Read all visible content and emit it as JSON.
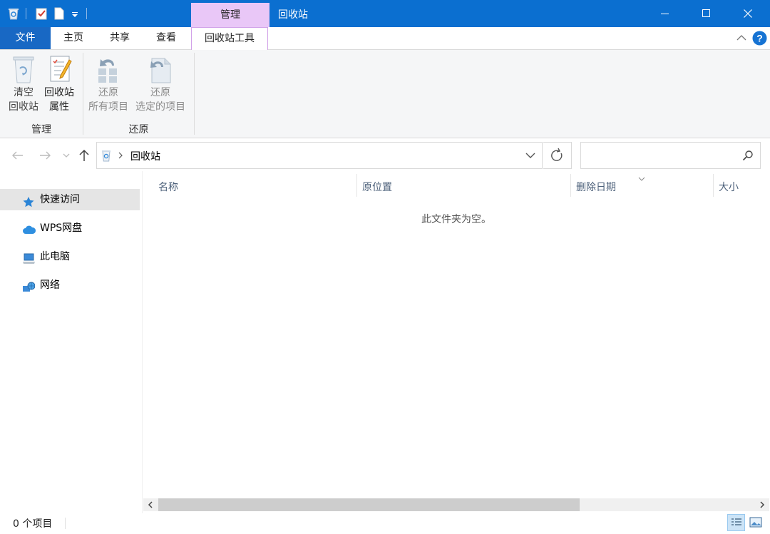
{
  "window": {
    "title": "回收站",
    "context_tab_label": "管理",
    "accent_color": "#0b6fd0"
  },
  "ribbon_tabs": {
    "file": "文件",
    "home": "主页",
    "share": "共享",
    "view": "查看",
    "tools": "回收站工具"
  },
  "ribbon": {
    "groups": [
      {
        "label": "管理",
        "buttons": [
          {
            "line1": "清空",
            "line2": "回收站"
          },
          {
            "line1": "回收站",
            "line2": "属性"
          }
        ]
      },
      {
        "label": "还原",
        "buttons": [
          {
            "line1": "还原",
            "line2": "所有项目"
          },
          {
            "line1": "还原",
            "line2": "选定的项目"
          }
        ]
      }
    ]
  },
  "address": {
    "crumb": "回收站",
    "search_placeholder": ""
  },
  "nav": {
    "items": [
      {
        "label": "快速访问",
        "icon": "star-icon",
        "selected": true
      },
      {
        "label": "WPS网盘",
        "icon": "cloud-icon",
        "selected": false
      },
      {
        "label": "此电脑",
        "icon": "computer-icon",
        "selected": false
      },
      {
        "label": "网络",
        "icon": "network-icon",
        "selected": false
      }
    ]
  },
  "columns": [
    "名称",
    "原位置",
    "删除日期",
    "大小"
  ],
  "empty_message": "此文件夹为空。",
  "status": {
    "item_count": "0 个项目"
  }
}
